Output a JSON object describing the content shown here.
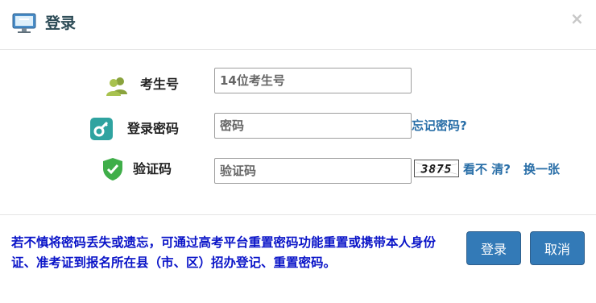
{
  "dialog": {
    "title": "登录",
    "close_symbol": "×",
    "icons": {
      "title": "computer-monitor-icon",
      "close": "close-icon"
    }
  },
  "form": {
    "exam_number": {
      "label": "考生号",
      "placeholder": "14位考生号",
      "value": "",
      "icon": "users-icon"
    },
    "password": {
      "label": "登录密码",
      "placeholder": "密码",
      "value": "",
      "icon": "key-icon"
    },
    "captcha": {
      "label": "验证码",
      "placeholder": "验证码",
      "value": "",
      "icon": "shield-check-icon",
      "image_text": "3875"
    }
  },
  "links": {
    "forgot_password": "忘记密码?",
    "unclear": "看不 清?",
    "refresh": "换一张"
  },
  "footer": {
    "notice": "若不慎将密码丢失或遗忘，可通过高考平台重置密码功能重置或携带本人身份 证、准考证到报名所在县（市、区）招办登记、重置密码。",
    "buttons": {
      "login": "登录",
      "cancel": "取消"
    }
  },
  "colors": {
    "primary_button": "#337ab7",
    "link": "#2a6fa8",
    "notice_text": "#0a14c8",
    "title_text": "#2b4a55"
  }
}
